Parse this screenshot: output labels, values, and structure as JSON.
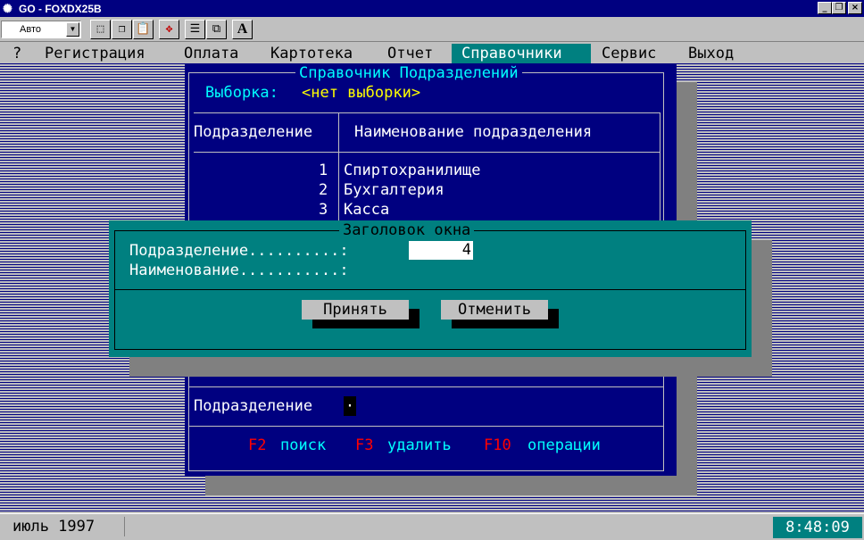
{
  "window": {
    "title": "GO - FOXDX25B",
    "controls": [
      "_",
      "❐",
      "×"
    ]
  },
  "toolbar": {
    "font_select": "Авто",
    "bold_button": "A"
  },
  "menu": {
    "items": [
      "?",
      "Регистрация",
      "Оплата",
      "Картотека",
      "Отчет",
      "Справочники",
      "Сервис",
      "Выход"
    ],
    "active": "Справочники"
  },
  "directory": {
    "title": "Справочник Подразделений",
    "selection_label": "Выборка:",
    "selection_value": "<нет выборки>",
    "columns": [
      "Подразделение",
      "Наименование подразделения"
    ],
    "rows": [
      {
        "id": "1",
        "name": "Спиртохранилище"
      },
      {
        "id": "2",
        "name": "Бухгалтерия"
      },
      {
        "id": "3",
        "name": "Касса"
      }
    ],
    "footer_label": "Подразделение",
    "footer_value": "·",
    "hotkeys": [
      {
        "key": "F2",
        "label": "поиск"
      },
      {
        "key": "F3",
        "label": "удалить"
      },
      {
        "key": "F10",
        "label": "операции"
      }
    ]
  },
  "dialog": {
    "title": "Заголовок окна",
    "fields": [
      {
        "label": "Подразделение..........:",
        "value": "4"
      },
      {
        "label": "Наименование...........:",
        "value": ""
      }
    ],
    "ok_label": "Принять",
    "cancel_label": "Отменить"
  },
  "status": {
    "date": "июль 1997",
    "time": "8:48:09"
  },
  "colors": {
    "dos_blue": "#000080",
    "teal": "#008080",
    "grey": "#c0c0c0",
    "hotkey": "#ff0000",
    "highlight": "#ffff00"
  }
}
